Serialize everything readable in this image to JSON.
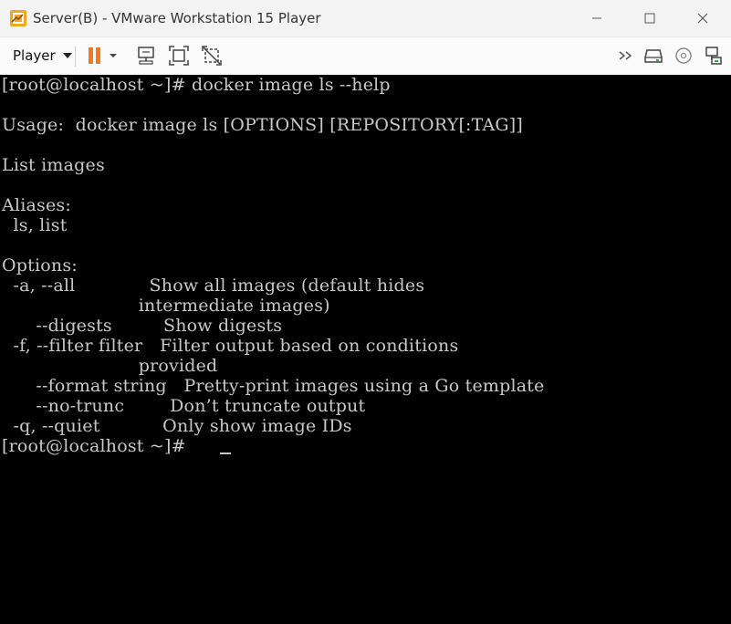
{
  "window": {
    "title": "Server(B) - VMware Workstation 15 Player"
  },
  "toolbar": {
    "player_label": "Player",
    "icons": [
      "pause-icon",
      "send-ctrl-alt-del-icon",
      "fit-guest-icon",
      "unity-icon",
      "forward-icon",
      "hdd-icon",
      "cd-icon",
      "network-icon"
    ],
    "pause_color": "#f07c1d"
  },
  "terminal": {
    "lines": [
      "[root@localhost ~]# docker image ls --help",
      "",
      "Usage:  docker image ls [OPTIONS] [REPOSITORY[:TAG]]",
      "",
      "List images",
      "",
      "Aliases:",
      "  ls, list",
      "",
      "Options:",
      "  -a, --all             Show all images (default hides",
      "                        intermediate images)",
      "      --digests         Show digests",
      "  -f, --filter filter   Filter output based on conditions",
      "                        provided",
      "      --format string   Pretty-print images using a Go template",
      "      --no-trunc        Don’t truncate output",
      "  -q, --quiet           Only show image IDs",
      "[root@localhost ~]# "
    ],
    "text_color": "#c8c8c8",
    "background": "#000000"
  }
}
